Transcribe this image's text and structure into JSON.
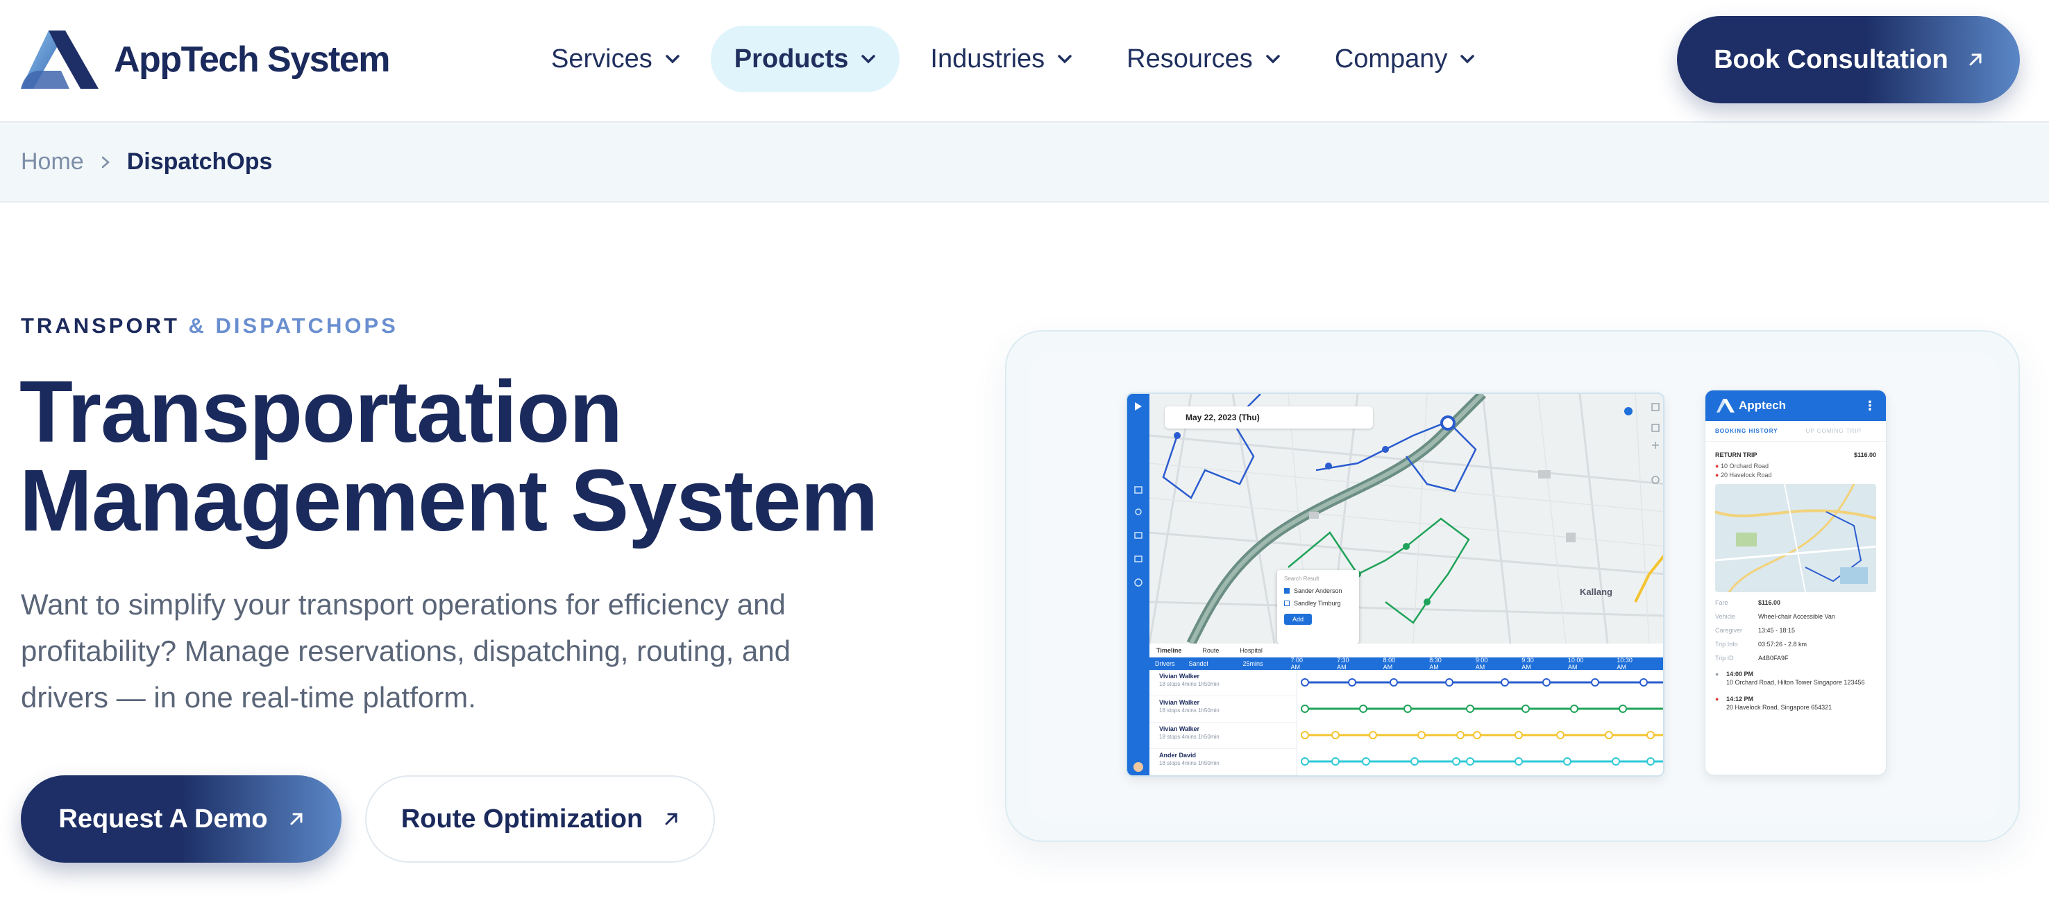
{
  "brand": {
    "name": "AppTech System"
  },
  "nav": {
    "items": [
      {
        "label": "Services",
        "active": false
      },
      {
        "label": "Products",
        "active": true
      },
      {
        "label": "Industries",
        "active": false
      },
      {
        "label": "Resources",
        "active": false
      },
      {
        "label": "Company",
        "active": false
      }
    ],
    "cta_label": "Book Consultation"
  },
  "breadcrumb": {
    "home": "Home",
    "current": "DispatchOps"
  },
  "hero": {
    "eyebrow_primary": "TRANSPORT",
    "eyebrow_secondary": "& DISPATCHOPS",
    "title_line1": "Transportation",
    "title_line2": "Management System",
    "description": "Want to simplify your transport operations for efficiency and profitability? Manage reservations, dispatching, routing, and drivers — in one real-time platform.",
    "primary_button": "Request A Demo",
    "secondary_button": "Route Optimization"
  },
  "dashboard": {
    "date": "May 22, 2023 (Thu)",
    "search_title": "Search Result",
    "search_options": [
      {
        "label": "Sander Anderson",
        "checked": true
      },
      {
        "label": "Sandley Timburg",
        "checked": false
      }
    ],
    "add_label": "Add",
    "timeline_tabs": [
      "Timeline",
      "Route",
      "Hospital"
    ],
    "timeline_bar": {
      "drivers_label": "Drivers",
      "filter": "Sandel",
      "interval": "25mins",
      "times": [
        "7:00 AM",
        "7:30 AM",
        "8:00 AM",
        "8:30 AM",
        "9:00 AM",
        "9:30 AM",
        "10:00 AM",
        "10:30 AM"
      ]
    },
    "drivers": [
      {
        "name": "Vivian Walker",
        "meta": "18 stops   4mins   1h50min"
      },
      {
        "name": "Vivian Walker",
        "meta": "18 stops   4mins   1h50min"
      },
      {
        "name": "Vivian Walker",
        "meta": "18 stops   4mins   1h50min"
      },
      {
        "name": "Ander David",
        "meta": "18 stops   4mins   1h50min"
      }
    ],
    "map_label": "Kallang",
    "colors": {
      "primary": "#1e6fd9",
      "green": "#1fa35a",
      "yellow": "#f4c430",
      "cyan": "#2fc9d6"
    }
  },
  "phone": {
    "app_name": "Apptech",
    "tab_active": "BOOKING HISTORY",
    "tab_inactive": "UP COMING TRIP",
    "trip_label": "RETURN TRIP",
    "trip_price": "$116.00",
    "from": "10 Orchard Road",
    "to": "20 Havelock Road",
    "fields": [
      {
        "key": "Fare",
        "value": "$116.00"
      },
      {
        "key": "Vehicle",
        "value": "Wheel-chair Accessible Van"
      },
      {
        "key": "Caregiver",
        "value": "13:45 - 18:15"
      },
      {
        "key": "Trip Info",
        "value": "03:57:26 -  2.8 km"
      },
      {
        "key": "Trip ID",
        "value": "A4B0FA9F"
      }
    ],
    "stops": [
      {
        "time": "14:00 PM",
        "address": "10 Orchard Road, Hilton Tower Singapore 123456"
      },
      {
        "time": "14:12 PM",
        "address": "20 Havelock Road, Singapore 654321"
      }
    ]
  }
}
